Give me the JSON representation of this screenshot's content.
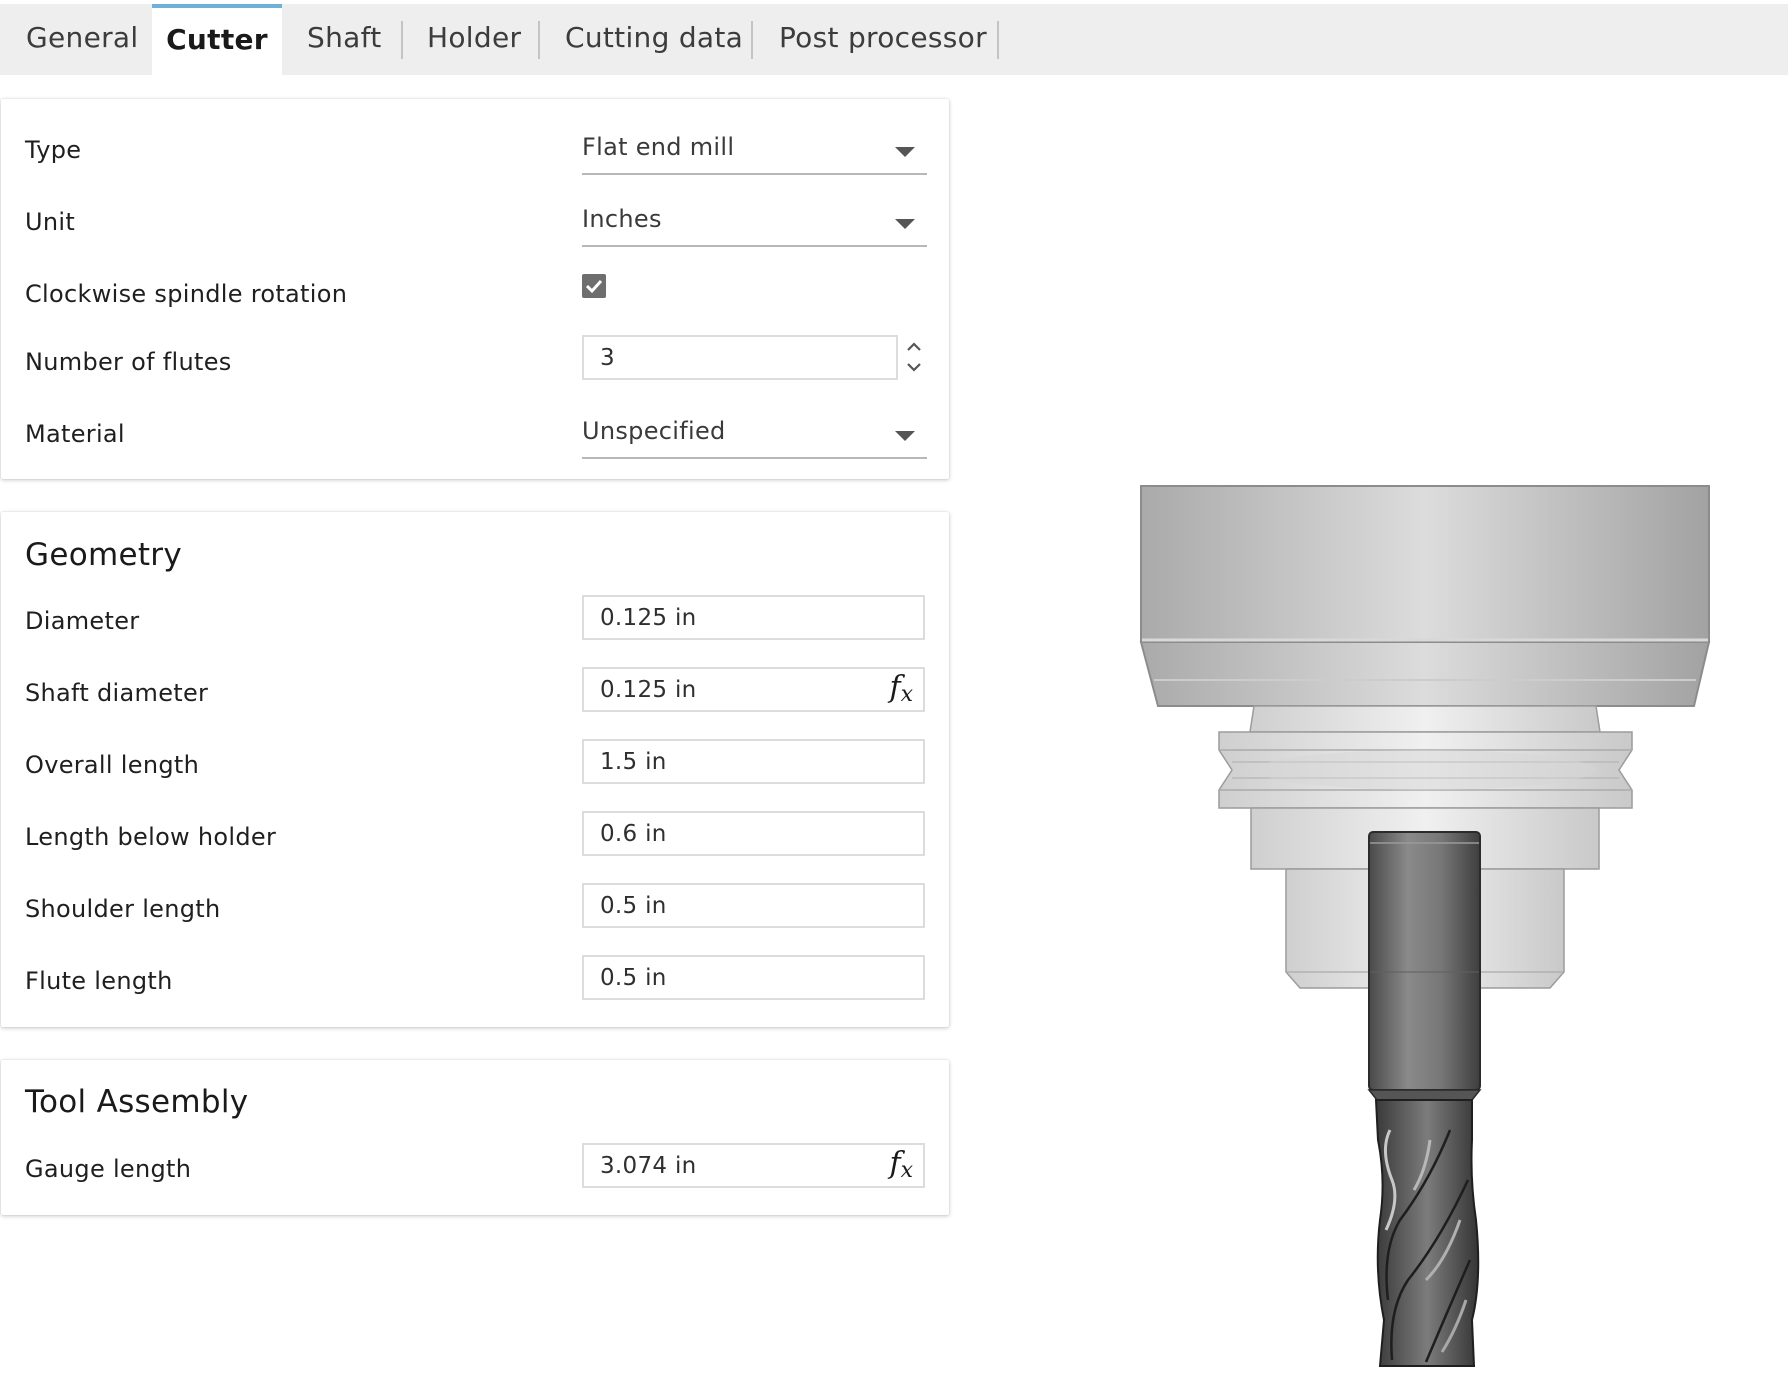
{
  "tabs": [
    {
      "label": "General"
    },
    {
      "label": "Cutter",
      "active": true
    },
    {
      "label": "Shaft"
    },
    {
      "label": "Holder"
    },
    {
      "label": "Cutting data"
    },
    {
      "label": "Post processor"
    }
  ],
  "cutter": {
    "type": {
      "label": "Type",
      "value": "Flat end mill"
    },
    "unit": {
      "label": "Unit",
      "value": "Inches"
    },
    "clockwise": {
      "label": "Clockwise spindle rotation",
      "checked": true
    },
    "flutes": {
      "label": "Number of flutes",
      "value": "3"
    },
    "material": {
      "label": "Material",
      "value": "Unspecified"
    }
  },
  "geometry": {
    "title": "Geometry",
    "diameter": {
      "label": "Diameter",
      "value": "0.125 in"
    },
    "shaft_diameter": {
      "label": "Shaft diameter",
      "value": "0.125 in"
    },
    "overall_length": {
      "label": "Overall length",
      "value": "1.5 in"
    },
    "length_below_holder": {
      "label": "Length below holder",
      "value": "0.6 in"
    },
    "shoulder_length": {
      "label": "Shoulder length",
      "value": "0.5 in"
    },
    "flute_length": {
      "label": "Flute length",
      "value": "0.5 in"
    }
  },
  "assembly": {
    "title": "Tool Assembly",
    "gauge_length": {
      "label": "Gauge length",
      "value": "3.074 in"
    }
  },
  "icons": {
    "dropdown": "caret-down-icon",
    "checkbox": "checkmark-icon",
    "stepper": "chevron-up-down-icon",
    "formula": "fx-icon"
  },
  "colors": {
    "active_tab_accent": "#6fb0d8",
    "tab_bar_bg": "#eeeeee",
    "checkbox_fill": "#6e6e6e"
  }
}
